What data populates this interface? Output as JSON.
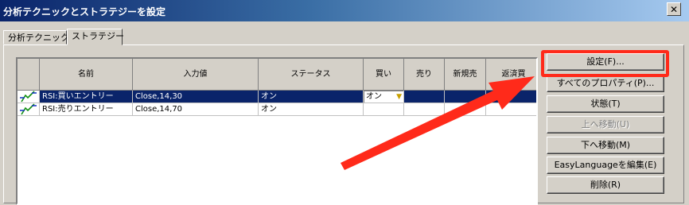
{
  "window": {
    "title": "分析テクニックとストラテジーを設定",
    "close_glyph": "✕"
  },
  "tabs": [
    {
      "label": "分析テクニック",
      "active": false
    },
    {
      "label": "ストラテジー",
      "active": true
    }
  ],
  "table": {
    "columns": [
      "",
      "名前",
      "入力値",
      "ステータス",
      "買い",
      "売り",
      "新規売",
      "返済買"
    ],
    "rows": [
      {
        "name": "RSI:買いエントリー",
        "input": "Close,14,30",
        "status": "オン",
        "buy": "オン",
        "sell": "",
        "new_sell": "",
        "cover_buy": "",
        "selected": true
      },
      {
        "name": "RSI:売りエントリー",
        "input": "Close,14,70",
        "status": "オン",
        "buy": "",
        "sell": "",
        "new_sell": "",
        "cover_buy": "",
        "selected": false
      }
    ],
    "dropdown_arrow": "▼"
  },
  "buttons": [
    {
      "label": "設定(F)...",
      "enabled": true
    },
    {
      "label": "すべてのプロパティ(P)...",
      "enabled": true
    },
    {
      "label": "状態(T)",
      "enabled": true
    },
    {
      "label": "上へ移動(U)",
      "enabled": false
    },
    {
      "label": "下へ移動(M)",
      "enabled": true
    },
    {
      "label": "EasyLanguageを編集(E)",
      "enabled": true
    },
    {
      "label": "削除(R)",
      "enabled": true
    }
  ],
  "colors": {
    "annotation": "#ff2a1a",
    "selection": "#0a246a"
  }
}
